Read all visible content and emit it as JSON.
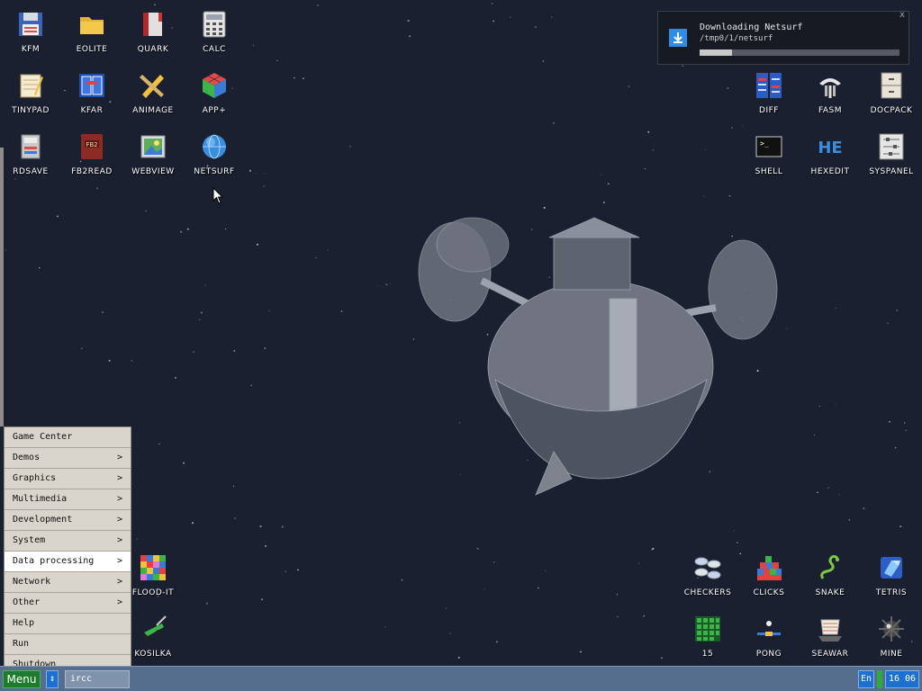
{
  "desktop_icons": [
    {
      "label": "KFM",
      "icon": "floppy-disk-icon"
    },
    {
      "label": "EOLITE",
      "icon": "folder-icon"
    },
    {
      "label": "QUARK",
      "icon": "book-icon"
    },
    {
      "label": "CALC",
      "icon": "calculator-icon"
    },
    {
      "label": "TINYPAD",
      "icon": "notepad-icon"
    },
    {
      "label": "KFAR",
      "icon": "archive-icon"
    },
    {
      "label": "ANIMAGE",
      "icon": "pencil-ruler-icon"
    },
    {
      "label": "APP+",
      "icon": "cube-icon"
    },
    {
      "label": "RDSAVE",
      "icon": "disk-save-icon"
    },
    {
      "label": "FB2READ",
      "icon": "fb2-book-icon"
    },
    {
      "label": "WEBVIEW",
      "icon": "web-image-icon"
    },
    {
      "label": "NETSURF",
      "icon": "globe-icon"
    },
    {
      "label": "DIFF",
      "icon": "diff-icon"
    },
    {
      "label": "FASM",
      "icon": "fasm-icon"
    },
    {
      "label": "DOCPACK",
      "icon": "cabinet-icon"
    },
    {
      "label": "SHELL",
      "icon": "terminal-icon"
    },
    {
      "label": "HEXEDIT",
      "icon": "hex-icon"
    },
    {
      "label": "SYSPANEL",
      "icon": "sliders-icon"
    },
    {
      "label": "FLOOD-IT",
      "icon": "color-grid-icon"
    },
    {
      "label": "KOSILKA",
      "icon": "lawn-mower-icon"
    },
    {
      "label": "CHECKERS",
      "icon": "checkers-icon"
    },
    {
      "label": "CLICKS",
      "icon": "blocks-icon"
    },
    {
      "label": "SNAKE",
      "icon": "snake-icon"
    },
    {
      "label": "TETRIS",
      "icon": "tetris-icon"
    },
    {
      "label": "15",
      "icon": "fifteen-grid-icon"
    },
    {
      "label": "PONG",
      "icon": "pong-icon"
    },
    {
      "label": "SEAWAR",
      "icon": "ship-icon"
    },
    {
      "label": "MINE",
      "icon": "mine-icon"
    }
  ],
  "notification": {
    "title": "Downloading Netsurf",
    "subtitle": "/tmp0/1/netsurf",
    "progress": 0.16,
    "close": "x"
  },
  "start_menu": {
    "items": [
      {
        "label": "Game Center",
        "arrow": ""
      },
      {
        "label": "Demos",
        "arrow": ">"
      },
      {
        "label": "Graphics",
        "arrow": ">"
      },
      {
        "label": "Multimedia",
        "arrow": ">"
      },
      {
        "label": "Development",
        "arrow": ">"
      },
      {
        "label": "System",
        "arrow": ">"
      },
      {
        "label": "Data processing",
        "arrow": ">"
      },
      {
        "label": "Network",
        "arrow": ">"
      },
      {
        "label": "Other",
        "arrow": ">"
      },
      {
        "label": "Help",
        "arrow": ""
      },
      {
        "label": "Run",
        "arrow": ""
      },
      {
        "label": "Shutdown",
        "arrow": ""
      }
    ],
    "selected": "Data processing"
  },
  "taskbar": {
    "menu_label": "Menu",
    "switch_label": "↕",
    "task_label": "ircc",
    "lang": "En",
    "clock": "16 06"
  },
  "colors": {
    "desktop_bg": "#1a2030",
    "taskbar": "#566e8e",
    "menu_bg": "#d9d5cc",
    "accent_blue": "#1d6fd0",
    "accent_green": "#1e7a2c"
  }
}
